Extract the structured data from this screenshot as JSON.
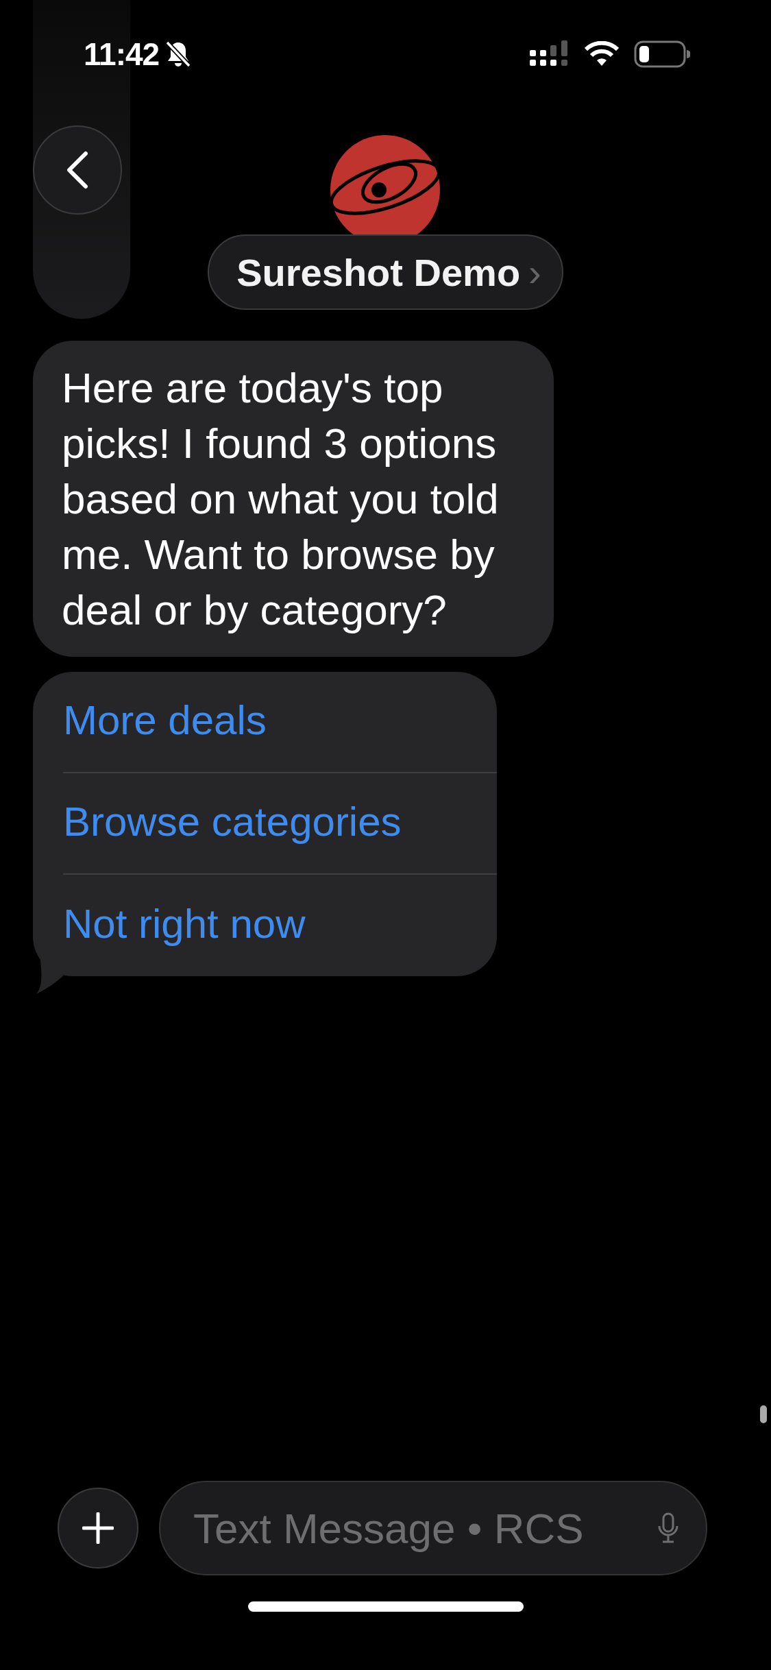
{
  "status_bar": {
    "time": "11:42"
  },
  "header": {
    "name": "Sureshot Demo",
    "chevron": "›"
  },
  "messages": [
    {
      "text": "Here are today's top picks! I found 3 options based on what you told me. Want to browse by deal or by category?"
    }
  ],
  "suggestions": [
    {
      "label": "More deals"
    },
    {
      "label": "Browse categories"
    },
    {
      "label": "Not right now"
    }
  ],
  "composer": {
    "placeholder": "Text Message • RCS"
  }
}
